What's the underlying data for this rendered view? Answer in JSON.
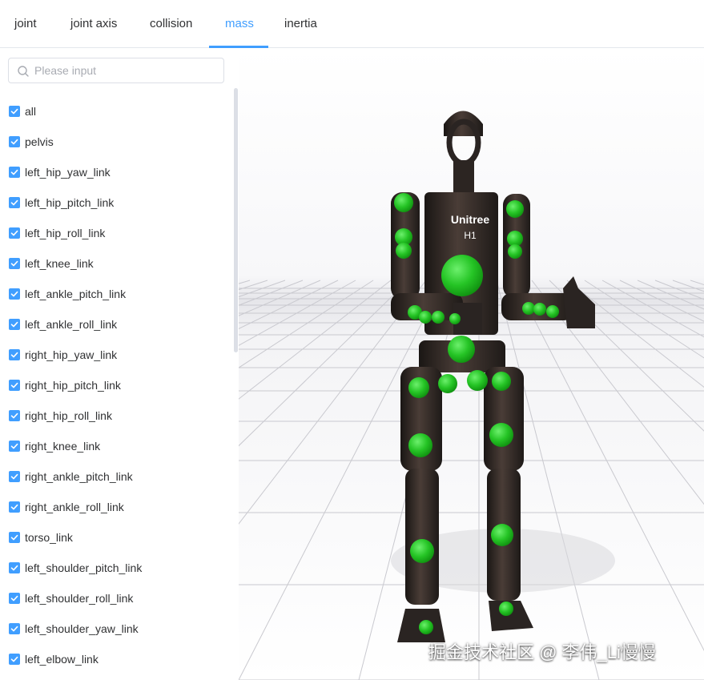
{
  "tabs": [
    {
      "label": "joint",
      "active": false
    },
    {
      "label": "joint axis",
      "active": false
    },
    {
      "label": "collision",
      "active": false
    },
    {
      "label": "mass",
      "active": true
    },
    {
      "label": "inertia",
      "active": false
    }
  ],
  "search": {
    "placeholder": "Please input",
    "value": ""
  },
  "links": [
    {
      "label": "all",
      "checked": true
    },
    {
      "label": "pelvis",
      "checked": true
    },
    {
      "label": "left_hip_yaw_link",
      "checked": true
    },
    {
      "label": "left_hip_pitch_link",
      "checked": true
    },
    {
      "label": "left_hip_roll_link",
      "checked": true
    },
    {
      "label": "left_knee_link",
      "checked": true
    },
    {
      "label": "left_ankle_pitch_link",
      "checked": true
    },
    {
      "label": "left_ankle_roll_link",
      "checked": true
    },
    {
      "label": "right_hip_yaw_link",
      "checked": true
    },
    {
      "label": "right_hip_pitch_link",
      "checked": true
    },
    {
      "label": "right_hip_roll_link",
      "checked": true
    },
    {
      "label": "right_knee_link",
      "checked": true
    },
    {
      "label": "right_ankle_pitch_link",
      "checked": true
    },
    {
      "label": "right_ankle_roll_link",
      "checked": true
    },
    {
      "label": "torso_link",
      "checked": true
    },
    {
      "label": "left_shoulder_pitch_link",
      "checked": true
    },
    {
      "label": "left_shoulder_roll_link",
      "checked": true
    },
    {
      "label": "left_shoulder_yaw_link",
      "checked": true
    },
    {
      "label": "left_elbow_link",
      "checked": true
    }
  ],
  "robot": {
    "brand": "Unitree",
    "model": "H1"
  },
  "watermark": "掘金技术社区 @ 李伟_Li慢慢",
  "colors": {
    "accent": "#409eff",
    "mass_marker": "#2ecc2e",
    "robot_body": "#2a2422"
  }
}
